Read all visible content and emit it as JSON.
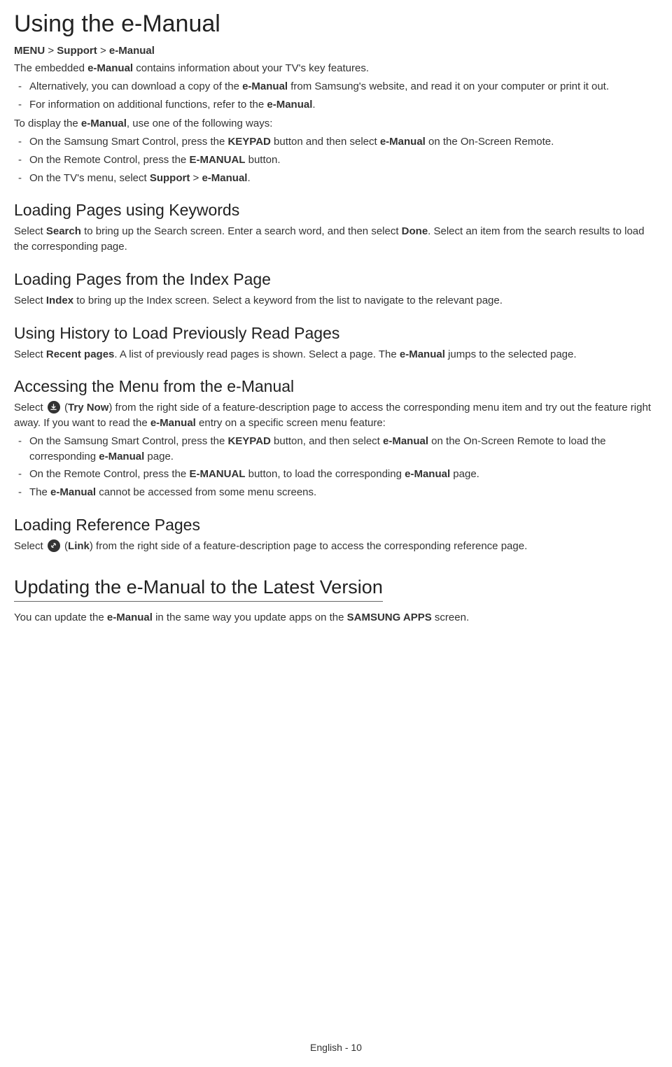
{
  "title": "Using the e-Manual",
  "breadcrumb": {
    "part1": "MENU",
    "sep1": " > ",
    "part2": "Support",
    "sep2": " > ",
    "part3": "e-Manual"
  },
  "intro": {
    "p1a": "The embedded ",
    "p1b": "e-Manual",
    "p1c": " contains information about your TV's key features.",
    "li1a": "Alternatively, you can download a copy of the ",
    "li1b": "e-Manual",
    "li1c": " from Samsung's website, and read it on your computer or print it out.",
    "li2a": "For information on additional functions, refer to the ",
    "li2b": "e-Manual",
    "li2c": ".",
    "p2a": "To display the ",
    "p2b": "e-Manual",
    "p2c": ", use one of the following ways:",
    "li3a": "On the Samsung Smart Control, press the ",
    "li3b": "KEYPAD",
    "li3c": " button and then select ",
    "li3d": "e-Manual",
    "li3e": " on the On-Screen Remote.",
    "li4a": "On the Remote Control, press the ",
    "li4b": "E-MANUAL",
    "li4c": " button.",
    "li5a": "On the TV's menu, select ",
    "li5b": "Support",
    "li5c": " > ",
    "li5d": "e-Manual",
    "li5e": "."
  },
  "sec1": {
    "title": "Loading Pages using Keywords",
    "p1a": "Select ",
    "p1b": "Search",
    "p1c": " to bring up the Search screen. Enter a search word, and then select ",
    "p1d": "Done",
    "p1e": ". Select an item from the search results to load the corresponding page."
  },
  "sec2": {
    "title": "Loading Pages from the Index Page",
    "p1a": "Select ",
    "p1b": "Index",
    "p1c": " to bring up the Index screen. Select a keyword from the list to navigate to the relevant page."
  },
  "sec3": {
    "title": "Using History to Load Previously Read Pages",
    "p1a": "Select ",
    "p1b": "Recent pages",
    "p1c": ". A list of previously read pages is shown. Select a page. The ",
    "p1d": "e-Manual",
    "p1e": " jumps to the selected page."
  },
  "sec4": {
    "title": "Accessing the Menu from the e-Manual",
    "p1a": "Select ",
    "p1b": " (",
    "p1c": "Try Now",
    "p1d": ") from the right side of a feature-description page to access the corresponding menu item and try out the feature right away. If you want to read the ",
    "p1e": "e-Manual",
    "p1f": " entry on a specific screen menu feature:",
    "li1a": "On the Samsung Smart Control, press the ",
    "li1b": "KEYPAD",
    "li1c": " button, and then select ",
    "li1d": "e-Manual",
    "li1e": " on the On-Screen Remote to load the corresponding ",
    "li1f": "e-Manual",
    "li1g": " page.",
    "li2a": "On the Remote Control, press the ",
    "li2b": "E-MANUAL",
    "li2c": " button, to load the corresponding ",
    "li2d": "e-Manual",
    "li2e": " page.",
    "li3a": "The ",
    "li3b": "e-Manual",
    "li3c": " cannot be accessed from some menu screens."
  },
  "sec5": {
    "title": "Loading Reference Pages",
    "p1a": "Select ",
    "p1b": " (",
    "p1c": "Link",
    "p1d": ") from the right side of a feature-description page to access the corresponding reference page."
  },
  "sec6": {
    "title": "Updating the e-Manual to the Latest Version",
    "p1a": "You can update the ",
    "p1b": "e-Manual",
    "p1c": " in the same way you update apps on the ",
    "p1d": "SAMSUNG APPS",
    "p1e": " screen."
  },
  "footer": "English - 10"
}
